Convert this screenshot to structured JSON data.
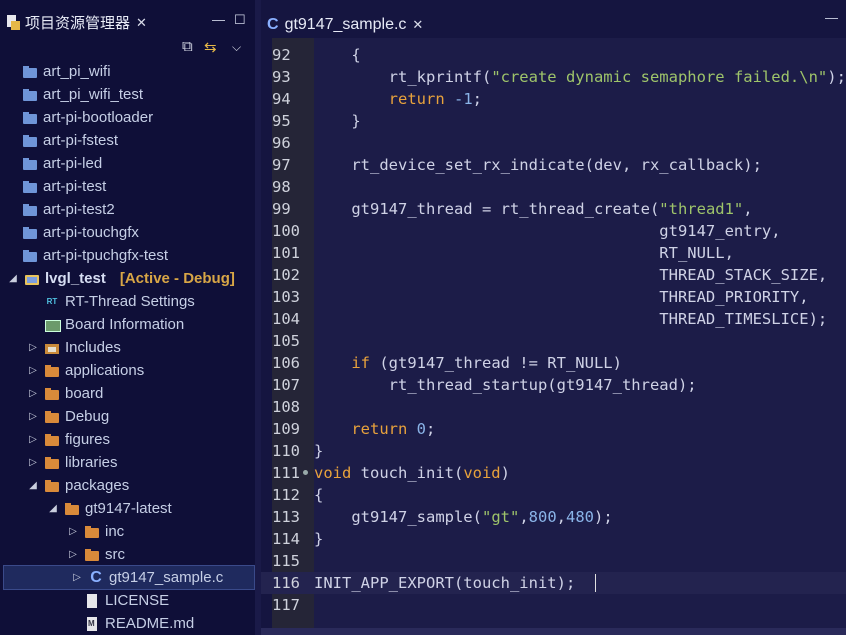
{
  "explorer": {
    "title": "项目资源管理器",
    "projects": [
      {
        "label": "art_pi_wifi"
      },
      {
        "label": "art_pi_wifi_test"
      },
      {
        "label": "art-pi-bootloader"
      },
      {
        "label": "art-pi-fstest"
      },
      {
        "label": "art-pi-led"
      },
      {
        "label": "art-pi-test"
      },
      {
        "label": "art-pi-test2"
      },
      {
        "label": "art-pi-touchgfx"
      },
      {
        "label": "art-pi-tpuchgfx-test"
      }
    ],
    "active_project": {
      "label": "lvgl_test",
      "status": "[Active - Debug]"
    },
    "children": [
      {
        "label": "RT-Thread Settings"
      },
      {
        "label": "Board Information"
      },
      {
        "label": "Includes"
      },
      {
        "label": "applications"
      },
      {
        "label": "board"
      },
      {
        "label": "Debug"
      },
      {
        "label": "figures"
      },
      {
        "label": "libraries"
      },
      {
        "label": "packages"
      },
      {
        "label": "gt9147-latest"
      },
      {
        "label": "inc"
      },
      {
        "label": "src"
      },
      {
        "label": "gt9147_sample.c"
      },
      {
        "label": "LICENSE"
      },
      {
        "label": "README.md"
      }
    ]
  },
  "editor": {
    "tab_label": "gt9147_sample.c",
    "lines": [
      {
        "n": "92",
        "t": "    {"
      },
      {
        "n": "93",
        "t": "        rt_kprintf(\"create dynamic semaphore failed.\\n\");"
      },
      {
        "n": "94",
        "t": "        return -1;"
      },
      {
        "n": "95",
        "t": "    }"
      },
      {
        "n": "96",
        "t": ""
      },
      {
        "n": "97",
        "t": "    rt_device_set_rx_indicate(dev, rx_callback);"
      },
      {
        "n": "98",
        "t": ""
      },
      {
        "n": "99",
        "t": "    gt9147_thread = rt_thread_create(\"thread1\","
      },
      {
        "n": "100",
        "t": "                                     gt9147_entry,"
      },
      {
        "n": "101",
        "t": "                                     RT_NULL,"
      },
      {
        "n": "102",
        "t": "                                     THREAD_STACK_SIZE,"
      },
      {
        "n": "103",
        "t": "                                     THREAD_PRIORITY,"
      },
      {
        "n": "104",
        "t": "                                     THREAD_TIMESLICE);"
      },
      {
        "n": "105",
        "t": ""
      },
      {
        "n": "106",
        "t": "    if (gt9147_thread != RT_NULL)"
      },
      {
        "n": "107",
        "t": "        rt_thread_startup(gt9147_thread);"
      },
      {
        "n": "108",
        "t": ""
      },
      {
        "n": "109",
        "t": "    return 0;"
      },
      {
        "n": "110",
        "t": "}"
      },
      {
        "n": "111",
        "t": "void touch_init(void)"
      },
      {
        "n": "112",
        "t": "{"
      },
      {
        "n": "113",
        "t": "    gt9147_sample(\"gt\",800,480);"
      },
      {
        "n": "114",
        "t": "}"
      },
      {
        "n": "115",
        "t": ""
      },
      {
        "n": "116",
        "t": "INIT_APP_EXPORT(touch_init);"
      },
      {
        "n": "117",
        "t": ""
      }
    ]
  }
}
